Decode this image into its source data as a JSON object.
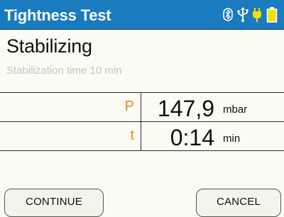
{
  "titlebar": {
    "title": "Tightness Test",
    "icons": [
      "bluetooth-icon",
      "usb-icon",
      "power-plug-icon",
      "battery-icon"
    ]
  },
  "content": {
    "heading": "Stabilizing",
    "subheading": "Stabilization time 10 min"
  },
  "measurements": [
    {
      "symbol": "P",
      "value": "147,9",
      "unit": "mbar"
    },
    {
      "symbol": "t",
      "value": "0:14",
      "unit": "min"
    }
  ],
  "buttons": {
    "continue_label": "CONTINUE",
    "cancel_label": "CANCEL"
  },
  "colors": {
    "titlebar": "#1a7bbf",
    "symbol": "#e08a1e",
    "battery": "#f5e100"
  }
}
